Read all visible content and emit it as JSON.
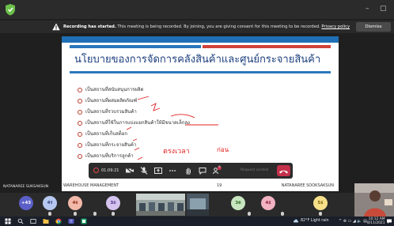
{
  "banner": {
    "title": "Recording has started.",
    "message": "This meeting is being recorded. By joining, you are giving consent for this meeting to be recorded.",
    "link": "Privacy policy",
    "dismiss_label": "Dismiss"
  },
  "slide": {
    "title": "นโยบายของการจัดการคลังสินค้าและศูนย์กระจายสินค้า",
    "bullets": [
      "เป็นสถานที่สนับสนุนการผลิต",
      "เป็นสถานที่ผสมผลิตภัณฑ์",
      "เป็นสถานที่รวบรวมสินค้า",
      "เป็นสถานที่ใช้ในการแบ่งแยกสินค้าให้มีขนาดเล็กลง",
      "เป็นสถานที่เก็บสต็อก",
      "เป็นสถานที่กระจายสินค้า",
      "เป็นสถานที่บริการลูกค้า"
    ],
    "annotation_1": "ตรงเวลา",
    "annotation_2": "ก่อน",
    "footer_left": "WAREHOUSE MANAGEMENT",
    "footer_page": "19",
    "footer_right": "NATANAREE SOOKSAKSUN"
  },
  "toolbar": {
    "timer": "01:09:21",
    "participants_count": "8",
    "request_control_label": "Request control"
  },
  "presenter_name": "NATANAREE SUKSAKSUN",
  "participants": [
    {
      "initials": "+43"
    },
    {
      "initials": "4ร"
    },
    {
      "initials": "4จ"
    },
    {
      "initials": "3ถ"
    },
    {
      "initials": "3ต"
    },
    {
      "initials": "4ธ"
    },
    {
      "initials": "5ธ"
    }
  ],
  "taskbar": {
    "weather": "82°F Light rain",
    "time": "10:12 AM",
    "date": "8/11/2021"
  },
  "colors": {
    "accent_blue": "#1e6fb5",
    "accent_red": "#d0423a",
    "leave_red": "#c4314b"
  }
}
